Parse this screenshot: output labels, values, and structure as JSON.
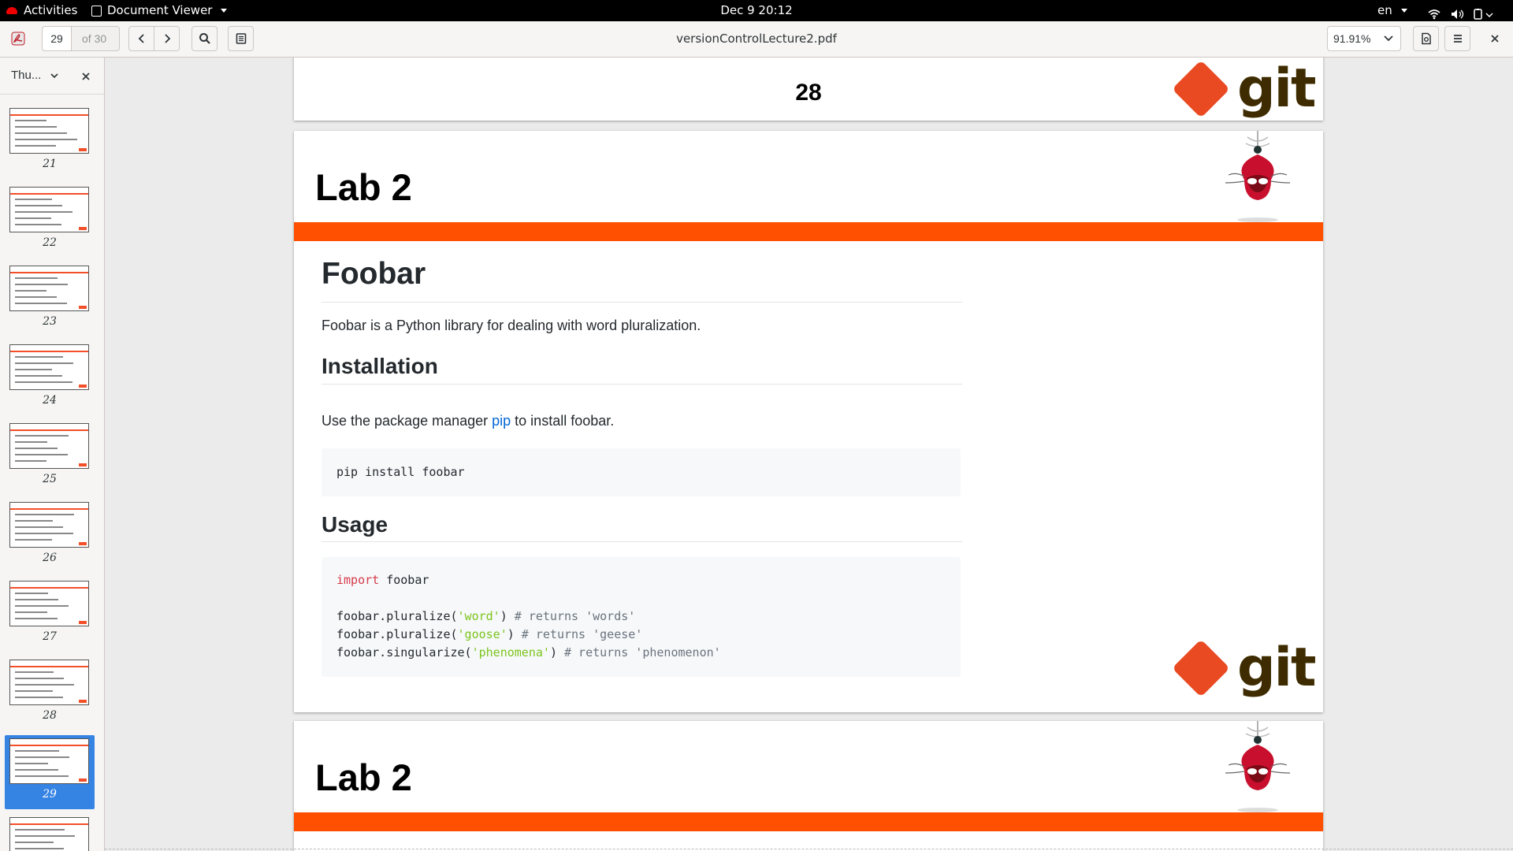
{
  "topbar": {
    "activities": "Activities",
    "app_name": "Document Viewer",
    "clock": "Dec 9  20:12",
    "language": "en"
  },
  "toolbar": {
    "page_input_value": "29",
    "page_total": "of 30",
    "document_title": "versionControlLecture2.pdf",
    "zoom_value": "91.91%"
  },
  "sidebar": {
    "mode_label": "Thu...",
    "thumbnails": [
      {
        "page": "21",
        "selected": false
      },
      {
        "page": "22",
        "selected": false
      },
      {
        "page": "23",
        "selected": false
      },
      {
        "page": "24",
        "selected": false
      },
      {
        "page": "25",
        "selected": false
      },
      {
        "page": "26",
        "selected": false
      },
      {
        "page": "27",
        "selected": false
      },
      {
        "page": "28",
        "selected": false
      },
      {
        "page": "29",
        "selected": true
      },
      {
        "page": "",
        "selected": false
      }
    ]
  },
  "pages": {
    "prev_page_number": "28",
    "current": {
      "title": "Lab 2",
      "readme": {
        "heading": "Foobar",
        "description": "Foobar is a Python library for dealing with word pluralization.",
        "installation_heading": "Installation",
        "install_text_before": "Use the package manager ",
        "install_link": "pip",
        "install_text_after": " to install foobar.",
        "install_command": "pip install foobar",
        "usage_heading": "Usage",
        "code": {
          "import_keyword": "import",
          "import_module": " foobar",
          "line1_call": "foobar.pluralize(",
          "line1_arg": "'word'",
          "line1_close": ")",
          "line1_comment": " # returns 'words'",
          "line2_call": "foobar.pluralize(",
          "line2_arg": "'goose'",
          "line2_close": ")",
          "line2_comment": " # returns 'geese'",
          "line3_call": "foobar.singularize(",
          "line3_arg": "'phenomena'",
          "line3_close": ")",
          "line3_comment": " # returns 'phenomenon'"
        }
      },
      "logo_text": "git"
    },
    "next": {
      "title": "Lab 2"
    }
  },
  "colors": {
    "accent_orange": "#ff4f00",
    "git_red": "#e94a22",
    "link_blue": "#0366d6",
    "selection_blue": "#3584e4"
  }
}
